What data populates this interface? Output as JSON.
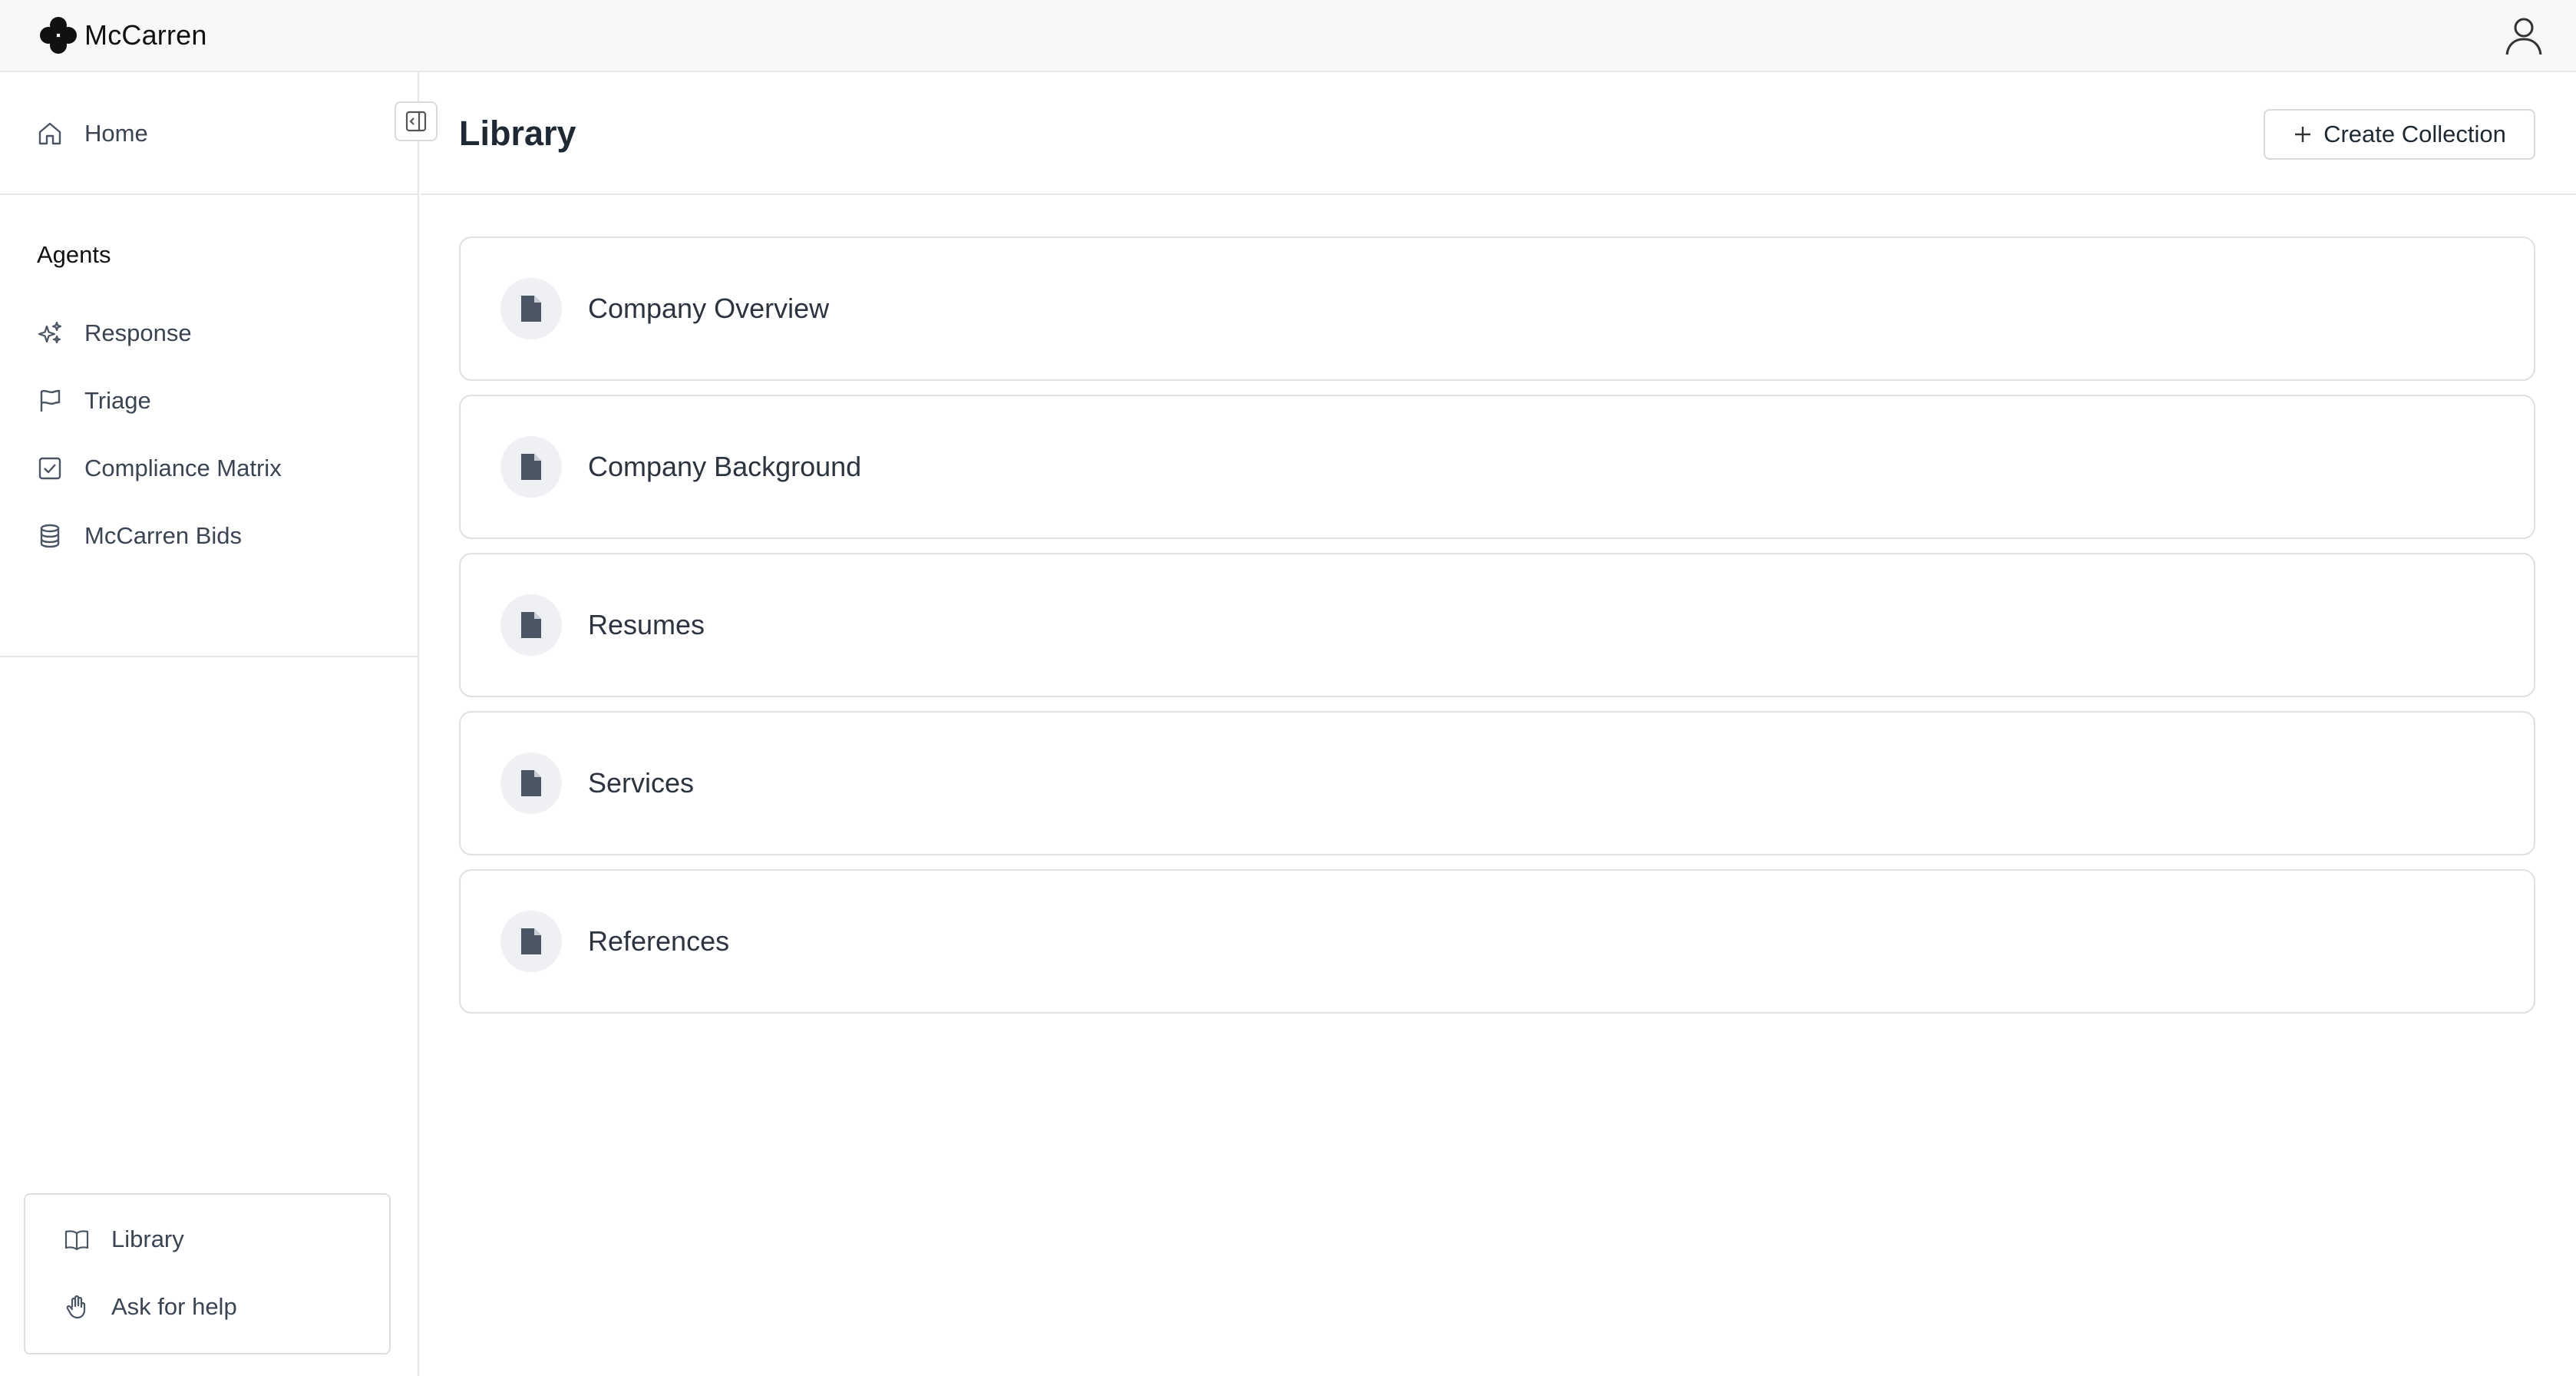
{
  "app": {
    "brand_name": "McCarren"
  },
  "sidebar": {
    "home_label": "Home",
    "agents_title": "Agents",
    "agents": [
      {
        "label": "Response",
        "icon": "sparkles-icon"
      },
      {
        "label": "Triage",
        "icon": "flag-icon"
      },
      {
        "label": "Compliance Matrix",
        "icon": "checkbox-icon"
      },
      {
        "label": "McCarren Bids",
        "icon": "database-icon"
      }
    ],
    "bottom": [
      {
        "label": "Library",
        "icon": "book-icon"
      },
      {
        "label": "Ask for help",
        "icon": "hand-icon"
      }
    ]
  },
  "main": {
    "title": "Library",
    "create_button_label": "Create Collection",
    "collections": [
      {
        "label": "Company Overview"
      },
      {
        "label": "Company Background"
      },
      {
        "label": "Resumes"
      },
      {
        "label": "Services"
      },
      {
        "label": "References"
      }
    ]
  },
  "colors": {
    "icon_gray": "#4b5563",
    "border": "#e0e0e0",
    "topbar_bg": "#f9f8f8"
  }
}
